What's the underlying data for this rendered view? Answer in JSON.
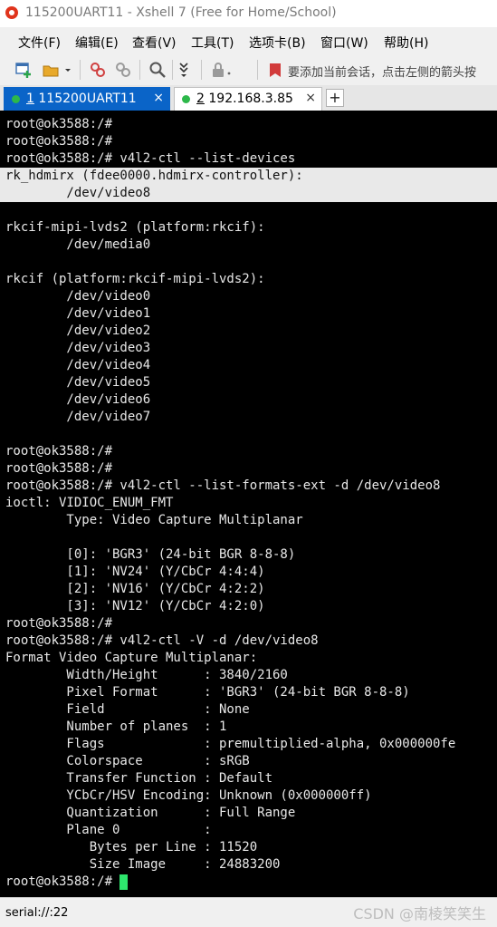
{
  "window": {
    "title": "115200UART11 - Xshell 7 (Free for Home/School)"
  },
  "menu": [
    "文件(F)",
    "编辑(E)",
    "查看(V)",
    "工具(T)",
    "选项卡(B)",
    "窗口(W)",
    "帮助(H)"
  ],
  "toolbar": {
    "hint": "要添加当前会话，点击左侧的箭头按"
  },
  "tabs": [
    {
      "number": "1",
      "label": "115200UART11",
      "status_color": "#2db84a",
      "active": true
    },
    {
      "number": "2",
      "label": "192.168.3.85",
      "status_color": "#2db84a",
      "active": false
    }
  ],
  "tab_add": "+",
  "tab_close": "×",
  "terminal": {
    "lines": [
      "root@ok3588:/#",
      "root@ok3588:/#",
      "root@ok3588:/# v4l2-ctl --list-devices",
      "rk_hdmirx (fdee0000.hdmirx-controller):",
      "        /dev/video8",
      "",
      "rkcif-mipi-lvds2 (platform:rkcif):",
      "        /dev/media0",
      "",
      "rkcif (platform:rkcif-mipi-lvds2):",
      "        /dev/video0",
      "        /dev/video1",
      "        /dev/video2",
      "        /dev/video3",
      "        /dev/video4",
      "        /dev/video5",
      "        /dev/video6",
      "        /dev/video7",
      "",
      "root@ok3588:/#",
      "root@ok3588:/#",
      "root@ok3588:/# v4l2-ctl --list-formats-ext -d /dev/video8",
      "ioctl: VIDIOC_ENUM_FMT",
      "        Type: Video Capture Multiplanar",
      "",
      "        [0]: 'BGR3' (24-bit BGR 8-8-8)",
      "        [1]: 'NV24' (Y/CbCr 4:4:4)",
      "        [2]: 'NV16' (Y/CbCr 4:2:2)",
      "        [3]: 'NV12' (Y/CbCr 4:2:0)",
      "root@ok3588:/#",
      "root@ok3588:/# v4l2-ctl -V -d /dev/video8",
      "Format Video Capture Multiplanar:",
      "        Width/Height      : 3840/2160",
      "        Pixel Format      : 'BGR3' (24-bit BGR 8-8-8)",
      "        Field             : None",
      "        Number of planes  : 1",
      "        Flags             : premultiplied-alpha, 0x000000fe",
      "        Colorspace        : sRGB",
      "        Transfer Function : Default",
      "        YCbCr/HSV Encoding: Unknown (0x000000ff)",
      "        Quantization      : Full Range",
      "        Plane 0           :",
      "           Bytes per Line : 11520",
      "           Size Image     : 24883200",
      "root@ok3588:/# "
    ],
    "highlighted_lines": [
      3,
      4
    ],
    "cursor_color": "#2ee66d"
  },
  "status": {
    "connection": "serial://:22"
  },
  "watermark": "CSDN @南棱笑笑生"
}
